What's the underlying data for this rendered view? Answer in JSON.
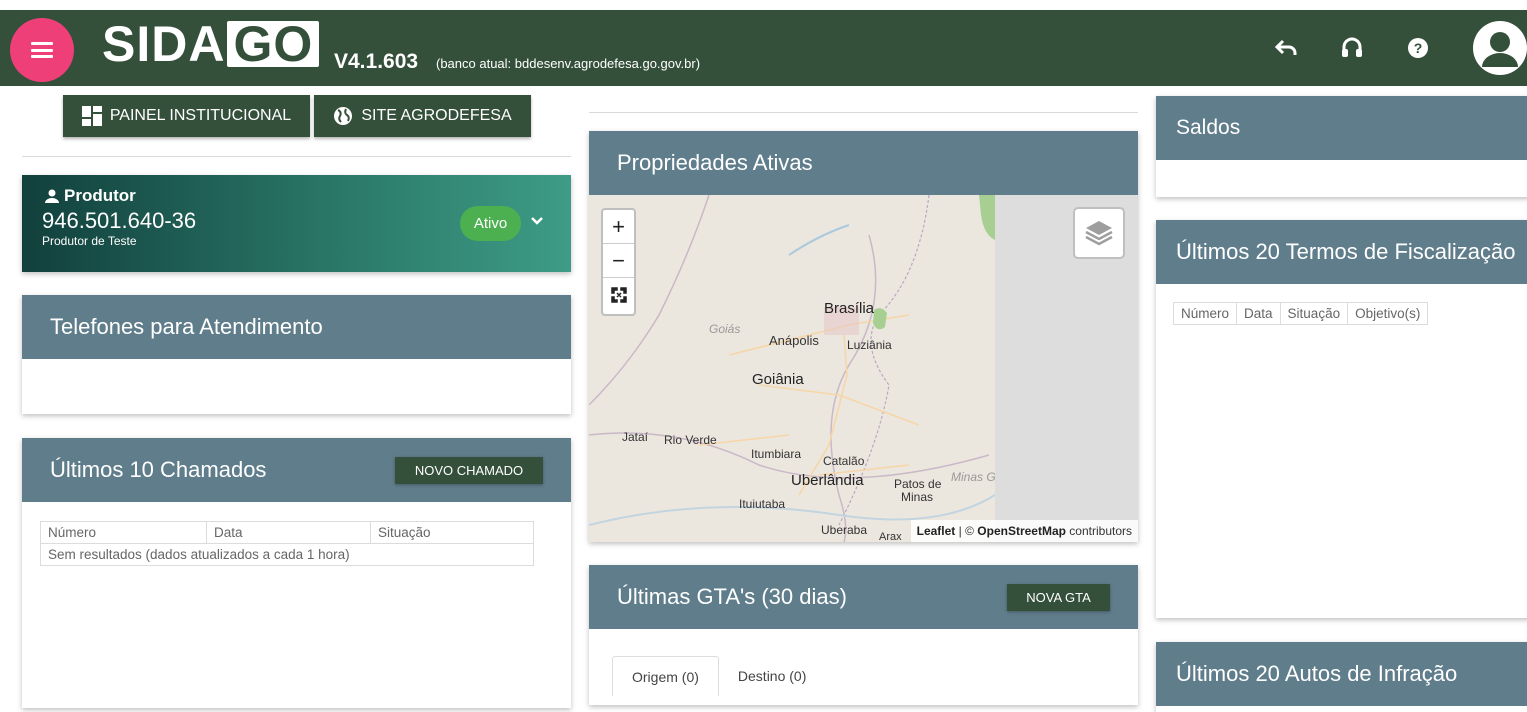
{
  "header": {
    "logo": "SIDAGO",
    "logo_first": "SIDA",
    "logo_second": "GO",
    "version": "V4.1.603",
    "bank": "(banco atual: bddesenv.agrodefesa.go.gov.br)",
    "icons": [
      "menu-icon",
      "undo-icon",
      "headset-icon",
      "help-icon",
      "account-icon"
    ]
  },
  "buttons": {
    "painel": "PAINEL INSTITUCIONAL",
    "site": "SITE AGRODEFESA"
  },
  "produtor": {
    "label": "Produtor",
    "number": "946.501.640-36",
    "name": "Produtor de Teste",
    "status": "Ativo"
  },
  "telefones": {
    "title": "Telefones para Atendimento"
  },
  "chamados": {
    "title": "Últimos 10 Chamados",
    "button": "NOVO CHAMADO",
    "columns": [
      "Número",
      "Data",
      "Situação"
    ],
    "empty": "Sem resultados (dados atualizados a cada 1 hora)"
  },
  "propriedades": {
    "title": "Propriedades Ativas",
    "map": {
      "zoom_in": "+",
      "zoom_out": "−",
      "cities": [
        "Brasília",
        "Goiás",
        "Anápolis",
        "Luziânia",
        "Goiânia",
        "Jataí",
        "Rio Verde",
        "Itumbiara",
        "Catalão",
        "Uberlândia",
        "Patos de",
        "Minas",
        "Minas Ge",
        "Ituiutaba",
        "Uberaba",
        "Arax"
      ],
      "attribution_leaflet": "Leaflet",
      "attribution_sep": " | © ",
      "attribution_osm": "OpenStreetMap",
      "attribution_rest": " contributors"
    }
  },
  "gtas": {
    "title": "Últimas GTA's (30 dias)",
    "button": "NOVA GTA",
    "tabs": [
      "Origem (0)",
      "Destino (0)"
    ]
  },
  "saldos": {
    "title": "Saldos"
  },
  "termos": {
    "title": "Últimos 20 Termos de Fiscalização",
    "columns": [
      "Número",
      "Data",
      "Situação",
      "Objetivo(s)"
    ]
  },
  "autos": {
    "title": "Últimos 20 Autos de Infração"
  },
  "colors": {
    "topbar": "#34503a",
    "menu_button": "#ef3f78",
    "card_header": "#607d8b",
    "badge": "#4caf50"
  }
}
